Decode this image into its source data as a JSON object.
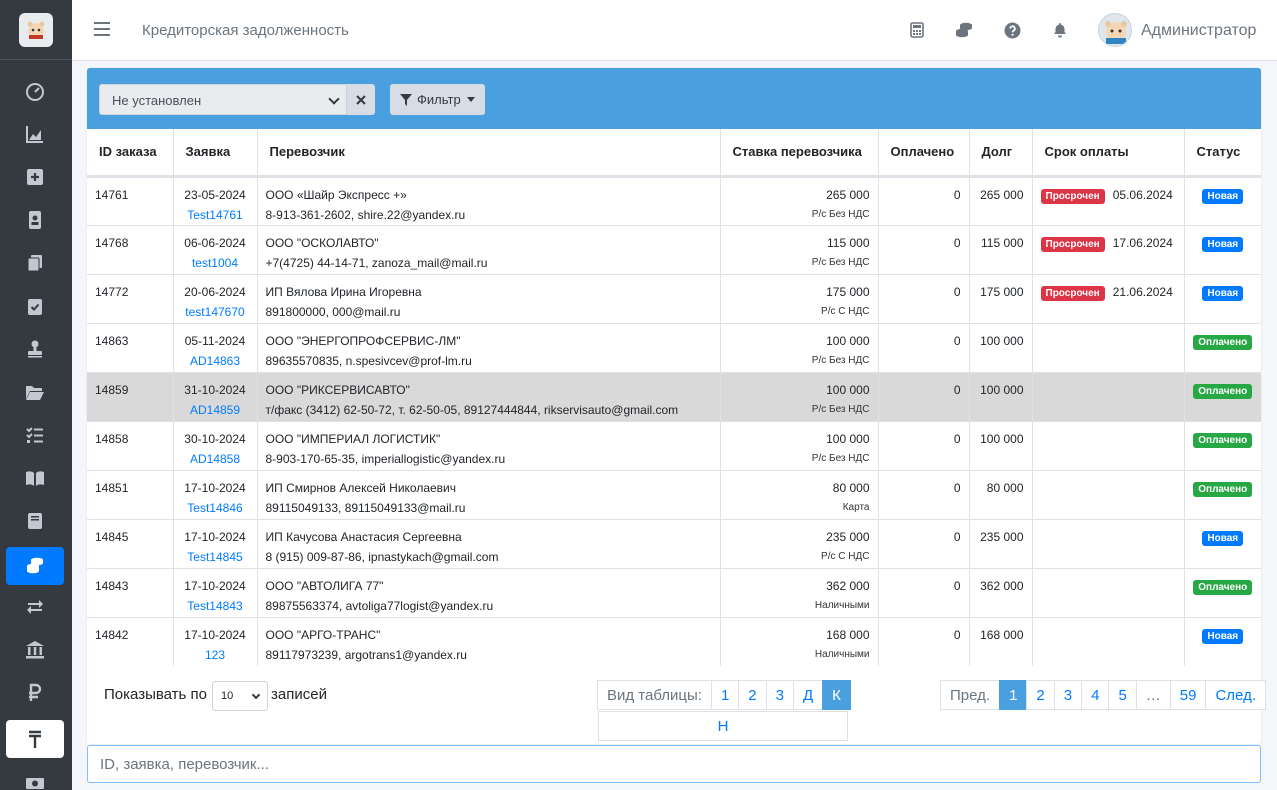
{
  "header": {
    "title": "Кредиторская задолженность",
    "user": "Администратор"
  },
  "toolbar": {
    "select_value": "Не установлен",
    "filter_label": "Фильтр"
  },
  "table": {
    "columns": [
      "ID заказа",
      "Заявка",
      "Перевозчик",
      "Ставка перевозчика",
      "Оплачено",
      "Долг",
      "Срок оплаты",
      "Статус"
    ],
    "rows": [
      {
        "id": "14761",
        "date": "23-05-2024",
        "req": "Test14761",
        "carrier": "ООО «Шайр Экспресс +»",
        "contact": "8-913-361-2602, shire.22@yandex.ru",
        "rate": "265 000",
        "pay_type": "Р/с Без НДС",
        "paid": "0",
        "debt": "265 000",
        "overdue": "Просрочен",
        "due": "05.06.2024",
        "status": "Новая",
        "status_kind": "new"
      },
      {
        "id": "14768",
        "date": "06-06-2024",
        "req": "test1004",
        "carrier": "ООО \"ОСКОЛАВТО\"",
        "contact": "+7(4725) 44-14-71, zanoza_mail@mail.ru",
        "rate": "115 000",
        "pay_type": "Р/с Без НДС",
        "paid": "0",
        "debt": "115 000",
        "overdue": "Просрочен",
        "due": "17.06.2024",
        "status": "Новая",
        "status_kind": "new"
      },
      {
        "id": "14772",
        "date": "20-06-2024",
        "req": "test147670",
        "carrier": "ИП Вялова Ирина Игоревна",
        "contact": "891800000, 000@mail.ru",
        "rate": "175 000",
        "pay_type": "Р/с С НДС",
        "paid": "0",
        "debt": "175 000",
        "overdue": "Просрочен",
        "due": "21.06.2024",
        "status": "Новая",
        "status_kind": "new"
      },
      {
        "id": "14863",
        "date": "05-11-2024",
        "req": "AD14863",
        "carrier": "ООО \"ЭНЕРГОПРОФСЕРВИС-ЛМ\"",
        "contact": "89635570835, n.spesivcev@prof-lm.ru",
        "rate": "100 000",
        "pay_type": "Р/с Без НДС",
        "paid": "0",
        "debt": "100 000",
        "overdue": "",
        "due": "",
        "status": "Оплачено",
        "status_kind": "paid"
      },
      {
        "id": "14859",
        "date": "31-10-2024",
        "req": "AD14859",
        "carrier": "ООО \"РИКСЕРВИСАВТО\"",
        "contact": "т/факс (3412) 62-50-72, т. 62-50-05, 89127444844, rikservisauto@gmail.com",
        "rate": "100 000",
        "pay_type": "Р/с Без НДС",
        "paid": "0",
        "debt": "100 000",
        "overdue": "",
        "due": "",
        "status": "Оплачено",
        "status_kind": "paid",
        "highlight": true
      },
      {
        "id": "14858",
        "date": "30-10-2024",
        "req": "AD14858",
        "carrier": "ООО \"ИМПЕРИАЛ ЛОГИСТИК\"",
        "contact": "8-903-170-65-35, imperiallogistic@yandex.ru",
        "rate": "100 000",
        "pay_type": "Р/с Без НДС",
        "paid": "0",
        "debt": "100 000",
        "overdue": "",
        "due": "",
        "status": "Оплачено",
        "status_kind": "paid"
      },
      {
        "id": "14851",
        "date": "17-10-2024",
        "req": "Test14846",
        "carrier": "ИП Смирнов Алексей Николаевич",
        "contact": "89115049133, 89115049133@mail.ru",
        "rate": "80 000",
        "pay_type": "Карта",
        "paid": "0",
        "debt": "80 000",
        "overdue": "",
        "due": "",
        "status": "Оплачено",
        "status_kind": "paid"
      },
      {
        "id": "14845",
        "date": "17-10-2024",
        "req": "Test14845",
        "carrier": "ИП Качусова Анастасия Сергеевна",
        "contact": "8 (915) 009-87-86, ipnastykach@gmail.com",
        "rate": "235 000",
        "pay_type": "Р/с С НДС",
        "paid": "0",
        "debt": "235 000",
        "overdue": "",
        "due": "",
        "status": "Новая",
        "status_kind": "new"
      },
      {
        "id": "14843",
        "date": "17-10-2024",
        "req": "Test14843",
        "carrier": "ООО \"АВТОЛИГА 77\"",
        "contact": "89875563374, avtoliga77logist@yandex.ru",
        "rate": "362 000",
        "pay_type": "Наличными",
        "paid": "0",
        "debt": "362 000",
        "overdue": "",
        "due": "",
        "status": "Оплачено",
        "status_kind": "paid"
      },
      {
        "id": "14842",
        "date": "17-10-2024",
        "req": "123",
        "carrier": "ООО \"АРГО-ТРАНС\"",
        "contact": "89117973239, argotrans1@yandex.ru",
        "rate": "168 000",
        "pay_type": "Наличными",
        "paid": "0",
        "debt": "168 000",
        "overdue": "",
        "due": "",
        "status": "Новая",
        "status_kind": "new"
      }
    ]
  },
  "footer": {
    "show_prefix": "Показывать по",
    "page_size": "10",
    "show_suffix": "записей",
    "view_label": "Вид таблицы:",
    "view_options": [
      "1",
      "2",
      "3",
      "Д",
      "К"
    ],
    "view_active": "К",
    "view_extra": "Н",
    "pagination": {
      "prev": "Пред.",
      "pages": [
        "1",
        "2",
        "3",
        "4",
        "5",
        "…",
        "59"
      ],
      "active": "1",
      "next": "След."
    }
  },
  "search": {
    "placeholder": "ID, заявка, перевозчик..."
  },
  "icons": {
    "sidebar": [
      "tachometer-icon",
      "chart-area-icon",
      "plus-square-icon",
      "id-badge-icon",
      "copy-icon",
      "clipboard-check-icon",
      "stamp-icon",
      "folder-open-icon",
      "tasks-icon",
      "book-open-icon",
      "book-icon",
      "coins-icon",
      "exchange-icon",
      "bank-icon",
      "ruble-icon",
      "tenge-icon",
      "money-bill-icon"
    ],
    "header": [
      "calculator-icon",
      "coins-icon",
      "question-circle-icon",
      "bell-icon"
    ]
  },
  "colors": {
    "sidebar_bg": "#343a40",
    "accent": "#007bff",
    "toolbar_bg": "#4aa0df",
    "overdue": "#dc3545",
    "paid": "#28a745"
  }
}
